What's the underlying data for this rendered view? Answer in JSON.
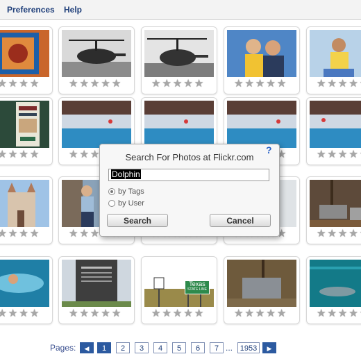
{
  "menu": {
    "preferences": "Preferences",
    "help": "Help"
  },
  "rating": {
    "star_glyph": "★",
    "star_color": "#a7a7a7"
  },
  "photos": [
    {
      "subject": "ornate tile"
    },
    {
      "subject": "helicopter"
    },
    {
      "subject": "helicopter"
    },
    {
      "subject": "couple portrait"
    },
    {
      "subject": "person portrait"
    },
    {
      "subject": "sign poster"
    },
    {
      "subject": "dolphin show stadium"
    },
    {
      "subject": "dolphin show stadium"
    },
    {
      "subject": "dolphin show stadium"
    },
    {
      "subject": "dolphin show stadium"
    },
    {
      "subject": "castle"
    },
    {
      "subject": "man with dog"
    },
    {
      "subject": "hidden"
    },
    {
      "subject": "hidden"
    },
    {
      "subject": "wrecked cars in forest"
    },
    {
      "subject": "person in water"
    },
    {
      "subject": "historical marker"
    },
    {
      "subject": "Texas state line sign"
    },
    {
      "subject": "old truck in woods"
    },
    {
      "subject": "dolphin in water"
    }
  ],
  "road_sign": {
    "line1": "Texas",
    "line2": "STATE LINE"
  },
  "dialog": {
    "title": "Search For Photos at Flickr.com",
    "help_symbol": "?",
    "query": "Dolphin",
    "option_tags": "by Tags",
    "option_user": "by User",
    "selected_option": "by Tags",
    "search_label": "Search",
    "cancel_label": "Cancel"
  },
  "pager": {
    "label": "Pages:",
    "prev_symbol": "◀",
    "next_symbol": "▶",
    "current_page": "1",
    "pages": [
      "1",
      "2",
      "3",
      "4",
      "5",
      "6",
      "7"
    ],
    "ellipsis": "...",
    "last_page": "1953"
  },
  "colors": {
    "accent": "#2c5aa0",
    "link": "#1f3f7a"
  }
}
